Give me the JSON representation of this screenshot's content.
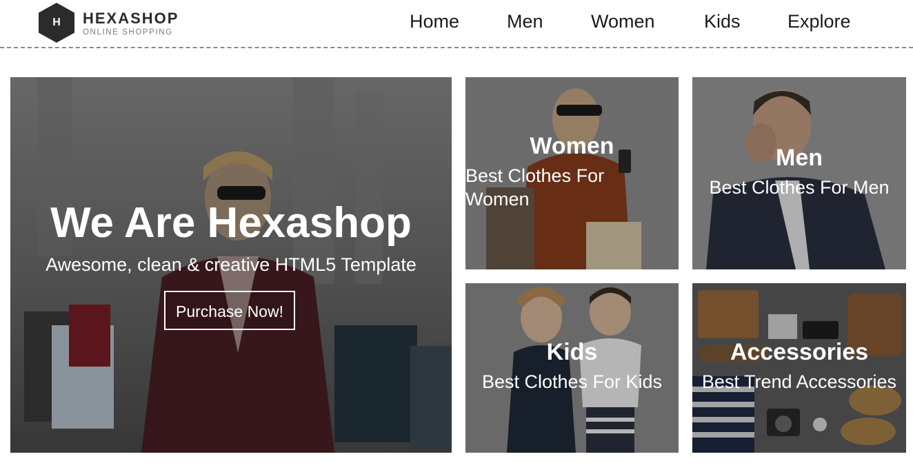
{
  "brand": {
    "logo_letter": "H",
    "name": "HEXASHOP",
    "tagline": "ONLINE SHOPPING"
  },
  "nav": {
    "items": [
      {
        "label": "Home"
      },
      {
        "label": "Men"
      },
      {
        "label": "Women"
      },
      {
        "label": "Kids"
      },
      {
        "label": "Explore"
      }
    ]
  },
  "hero": {
    "title": "We Are Hexashop",
    "subtitle": "Awesome, clean & creative HTML5 Template",
    "button_label": "Purchase Now!"
  },
  "categories": [
    {
      "title": "Women",
      "subtitle_line1": "Best Clothes For",
      "subtitle_line2": "Women"
    },
    {
      "title": "Men",
      "subtitle": "Best Clothes For Men"
    },
    {
      "title": "Kids",
      "subtitle": "Best Clothes For Kids"
    },
    {
      "title": "Accessories",
      "subtitle": "Best Trend Accessories"
    }
  ],
  "colors": {
    "text": "#1a1a1a",
    "logo_hex": "#2b2b2b",
    "header_divider": "#8a8a8a",
    "overlay_text": "#ffffff"
  }
}
